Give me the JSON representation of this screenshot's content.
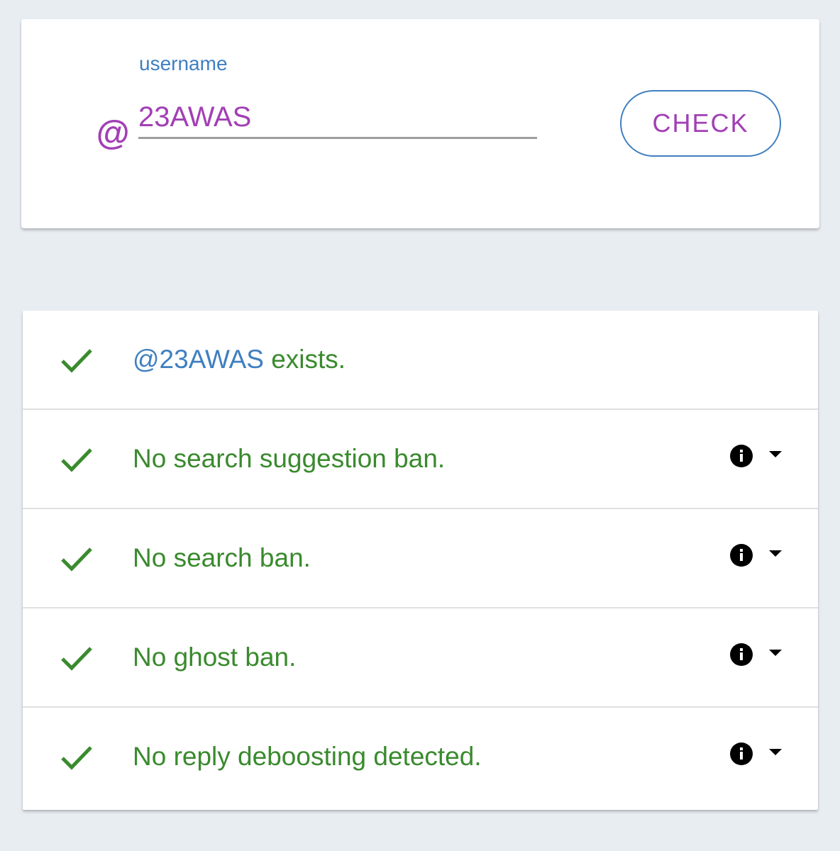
{
  "search": {
    "label": "username",
    "prefix": "@",
    "value": "23AWAS",
    "button_label": "CHECK"
  },
  "results": [
    {
      "handle": "@23AWAS",
      "text": " exists.",
      "status": "pass",
      "icon": "check-icon",
      "has_info": false
    },
    {
      "text": "No search suggestion ban.",
      "status": "pass",
      "icon": "check-icon",
      "has_info": true
    },
    {
      "text": "No search ban.",
      "status": "pass",
      "icon": "check-icon",
      "has_info": true
    },
    {
      "text": "No ghost ban.",
      "status": "pass",
      "icon": "check-icon",
      "has_info": true
    },
    {
      "text": "No reply deboosting detected.",
      "status": "pass",
      "icon": "check-icon",
      "has_info": true
    }
  ],
  "colors": {
    "accent_purple": "#a23fb5",
    "accent_blue": "#3f7fc0",
    "success_green": "#3a8a2e",
    "background": "#e8edf2"
  }
}
